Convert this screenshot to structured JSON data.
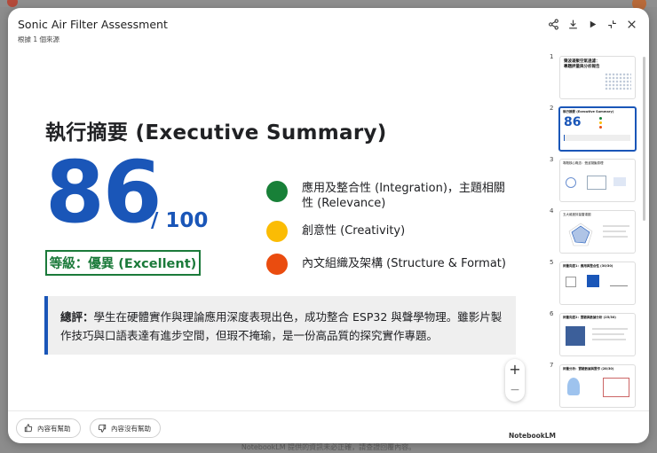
{
  "app": {
    "title": "Sonic Air Filter Assessment",
    "subtitle": "根據 1 個來源",
    "footer_note": "NotebookLM 提供的資訊未必正確，請查證回覆內容。"
  },
  "header_icons": [
    "share-icon",
    "download-icon",
    "play-icon",
    "collapse-icon",
    "close-icon"
  ],
  "slide": {
    "title": "執行摘要 (Executive Summary)",
    "score": "86",
    "out_of": "/ 100",
    "grade": "等級：優異 (Excellent)",
    "criteria": [
      {
        "color": "#188038",
        "label": "應用及整合性 (Integration)，主題相關性 (Relevance)"
      },
      {
        "color": "#fbbc04",
        "label": "創意性 (Creativity)"
      },
      {
        "color": "#ea4c0f",
        "label": "內文組織及架構 (Structure & Format)"
      }
    ],
    "comment_label": "總評：",
    "comment_text": "學生在硬體實作與理論應用深度表現出色，成功整合 ESP32 與聲學物理。雖影片製作技巧與口語表達有進步空間，但瑕不掩瑜，是一份高品質的探究實作專題。",
    "brand_text": "NotebookLM"
  },
  "zoom": {
    "plus": "+",
    "minus": "−"
  },
  "thumbnails": [
    {
      "num": "1",
      "text": "聲波凝聚空氣過濾：專題評量與分析報告"
    },
    {
      "num": "2",
      "text": "執行摘要 (Executive Summary)",
      "selected": true
    },
    {
      "num": "3",
      "text": "專題核心概念：聲波凝聚原理"
    },
    {
      "num": "4",
      "text": "五大維度評量雷達圖"
    },
    {
      "num": "5",
      "text": "評量向度1：應用與整合性 (30/30)"
    },
    {
      "num": "6",
      "text": "評量向度2：實驗與數據分析 (25/30)"
    },
    {
      "num": "7",
      "text": "評量分析：實驗數據與實作 (28/30)"
    }
  ],
  "footer": {
    "helpful": "內容有幫助",
    "not_helpful": "內容沒有幫助"
  },
  "colors": {
    "accent": "#1a56b8",
    "grade": "#1b7a3a"
  }
}
